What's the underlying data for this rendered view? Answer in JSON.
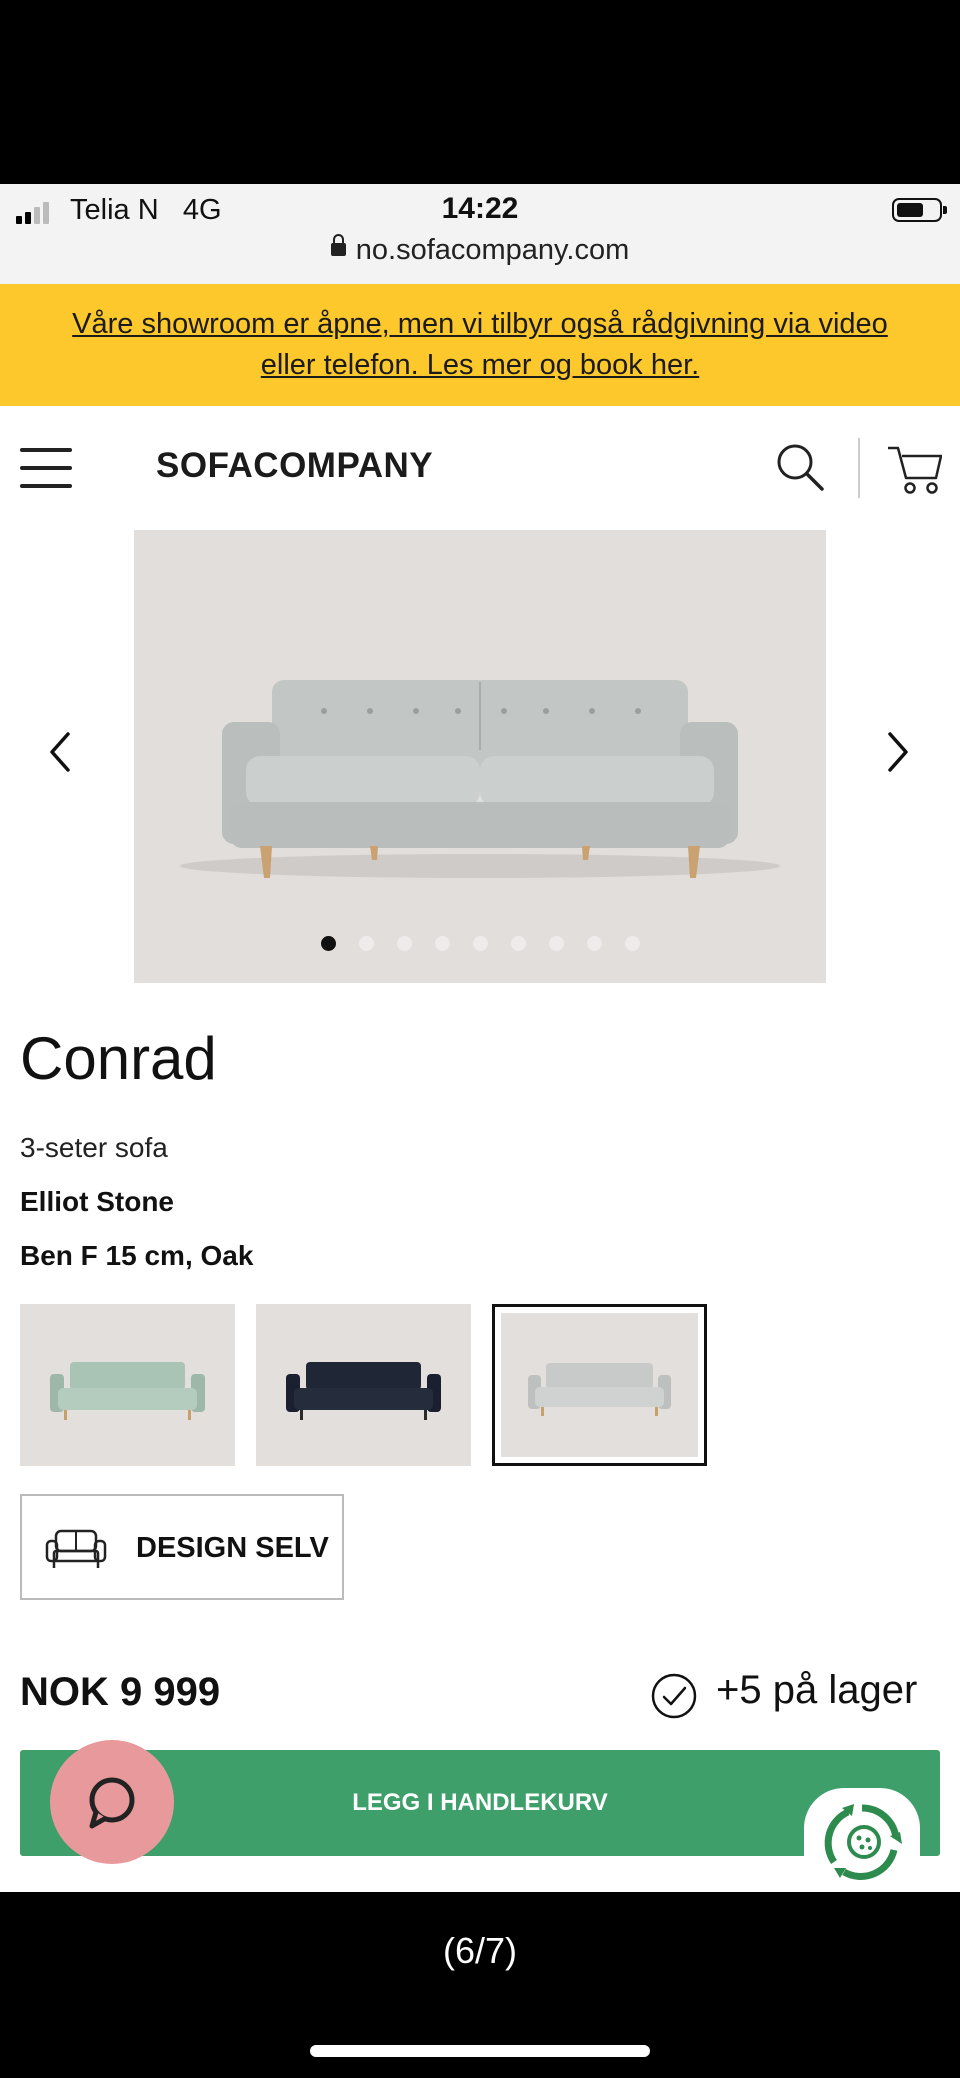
{
  "status_bar": {
    "carrier": "Telia N",
    "network": "4G",
    "time": "14:22",
    "url": "no.sofacompany.com"
  },
  "banner": {
    "text": "Våre showroom er åpne, men vi tilbyr også rådgivning via video eller telefon. Les mer og book her."
  },
  "header": {
    "brand": "SOFACOMPANY",
    "icons": [
      "menu-icon",
      "search-icon",
      "cart-icon"
    ]
  },
  "gallery": {
    "image_count": 9,
    "active_index": 0,
    "colors": {
      "background": "#e1dedc",
      "sofa": "#c2c6c4"
    }
  },
  "product": {
    "name": "Conrad",
    "type": "3-seter sofa",
    "fabric": "Elliot Stone",
    "legs": "Ben F 15 cm, Oak"
  },
  "variants": [
    {
      "color": "#a9c3b5",
      "leg": "#c9a06c",
      "selected": false
    },
    {
      "color": "#1f2635",
      "leg": "#2a2a2a",
      "selected": false
    },
    {
      "color": "#c7cac8",
      "leg": "#c9a06c",
      "selected": true
    }
  ],
  "design_button": {
    "label": "DESIGN SELV"
  },
  "pricing": {
    "price": "NOK 9 999",
    "stock": "+5 på lager"
  },
  "cart_button": {
    "label": "LEGG I HANDLEKURV",
    "color": "#3e9f6a"
  },
  "chat": {
    "color": "#e8999c"
  },
  "caption": "(6/7)"
}
